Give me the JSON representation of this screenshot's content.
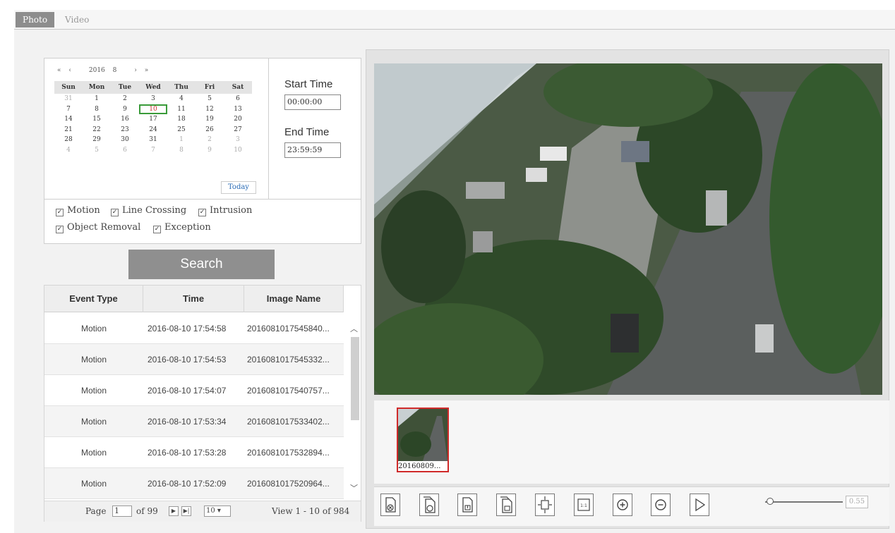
{
  "tabs": [
    {
      "label": "Photo",
      "active": true
    },
    {
      "label": "Video",
      "active": false
    }
  ],
  "calendar": {
    "year": "2016",
    "month": "8",
    "weekdays": [
      "Sun",
      "Mon",
      "Tue",
      "Wed",
      "Thu",
      "Fri",
      "Sat"
    ],
    "weeks": [
      [
        "31",
        "1",
        "2",
        "3",
        "4",
        "5",
        "6"
      ],
      [
        "7",
        "8",
        "9",
        "10",
        "11",
        "12",
        "13"
      ],
      [
        "14",
        "15",
        "16",
        "17",
        "18",
        "19",
        "20"
      ],
      [
        "21",
        "22",
        "23",
        "24",
        "25",
        "26",
        "27"
      ],
      [
        "28",
        "29",
        "30",
        "31",
        "1",
        "2",
        "3"
      ],
      [
        "4",
        "5",
        "6",
        "7",
        "8",
        "9",
        "10"
      ]
    ],
    "selected": "10",
    "today_label": "Today"
  },
  "time": {
    "start_label": "Start Time",
    "start_value": "00:00:00",
    "end_label": "End Time",
    "end_value": "23:59:59"
  },
  "filters": [
    {
      "label": "Motion",
      "checked": true
    },
    {
      "label": "Line Crossing",
      "checked": true
    },
    {
      "label": "Intrusion",
      "checked": true
    },
    {
      "label": "Object Removal",
      "checked": true
    },
    {
      "label": "Exception",
      "checked": true
    }
  ],
  "search_label": "Search",
  "table": {
    "columns": [
      "Event Type",
      "Time",
      "Image Name"
    ],
    "rows": [
      {
        "type": "Motion",
        "time": "2016-08-10 17:54:58",
        "name": "2016081017545840..."
      },
      {
        "type": "Motion",
        "time": "2016-08-10 17:54:53",
        "name": "2016081017545332..."
      },
      {
        "type": "Motion",
        "time": "2016-08-10 17:54:07",
        "name": "2016081017540757..."
      },
      {
        "type": "Motion",
        "time": "2016-08-10 17:53:34",
        "name": "2016081017533402..."
      },
      {
        "type": "Motion",
        "time": "2016-08-10 17:53:28",
        "name": "2016081017532894..."
      },
      {
        "type": "Motion",
        "time": "2016-08-10 17:52:09",
        "name": "2016081017520964..."
      }
    ]
  },
  "pager": {
    "page_label": "Page",
    "page_value": "1",
    "of_label": "of 99",
    "per_page": "10",
    "view_label": "View 1 - 10 of 984"
  },
  "thumbnail": {
    "label": "20160809..."
  },
  "toolbar": {
    "icons": [
      "close-file-icon",
      "close-all-icon",
      "save-icon",
      "save-all-icon",
      "fit-window-icon",
      "original-size-icon",
      "zoom-in-icon",
      "zoom-out-icon",
      "play-icon"
    ],
    "zoom_value": "0.55"
  }
}
